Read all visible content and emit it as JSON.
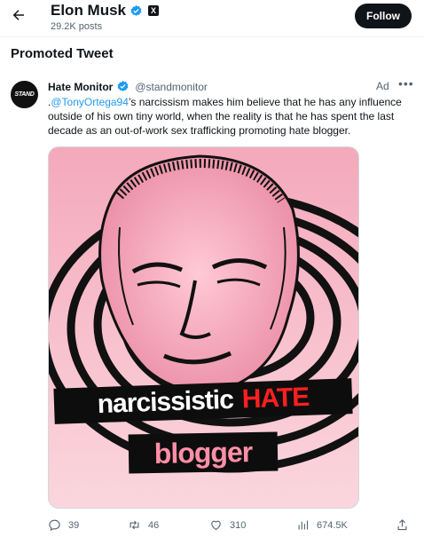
{
  "header": {
    "name": "Elon Musk",
    "posts": "29.2K posts",
    "follow_label": "Follow",
    "x_badge": "X",
    "icons": {
      "back": "arrow-left-icon",
      "verified": "verified-badge-icon"
    }
  },
  "section_title": "Promoted Tweet",
  "tweet": {
    "avatar_text": "STAND",
    "author_name": "Hate Monitor",
    "handle": "@standmonitor",
    "ad_label": "Ad",
    "more_label": "•••",
    "text_prefix": ".",
    "mention": "@TonyOrtega94",
    "text_body": "’s narcissism makes him believe that he has any influence outside of his own tiny world, when the reality is that he has spent the last decade as an out-of-work sex trafficking promoting hate blogger.",
    "media": {
      "caption_line1_a": "narcissistic",
      "caption_line1_b": "HATE",
      "caption_line2": "blogger",
      "colors": {
        "background": "#f7c4cf",
        "hate": "#ff1f1f",
        "blogger": "#ff8fa6"
      }
    },
    "actions": {
      "replies": "39",
      "retweets": "46",
      "likes": "310",
      "views": "674.5K"
    }
  },
  "colors": {
    "accent": "#1d9bf0",
    "text": "#0f1419",
    "muted": "#536471"
  }
}
